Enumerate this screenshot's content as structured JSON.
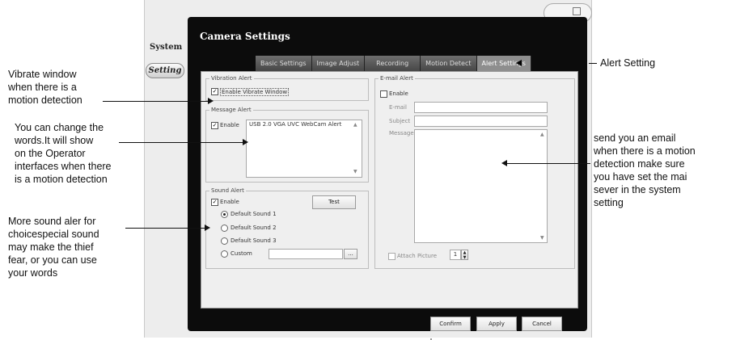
{
  "sidebar": {
    "system_label": "System",
    "setting_button": "Setting"
  },
  "window": {
    "title": "Camera Settings"
  },
  "tabs": [
    {
      "label": "Basic Settings",
      "active": false
    },
    {
      "label": "Image Adjust",
      "active": false
    },
    {
      "label": "Recording",
      "active": false
    },
    {
      "label": "Motion Detect",
      "active": false
    },
    {
      "label": "Alert Settings",
      "active": true
    }
  ],
  "vibration_alert": {
    "title": "Vibration Alert",
    "checkbox_label": "Enable Vibrate Window",
    "checked": true
  },
  "message_alert": {
    "title": "Message Alert",
    "enable_label": "Enable",
    "checked": true,
    "message": "USB 2.0 VGA UVC WebCam Alert"
  },
  "sound_alert": {
    "title": "Sound Alert",
    "enable_label": "Enable",
    "checked": true,
    "test_button": "Test",
    "options": [
      "Default Sound 1",
      "Default Sound 2",
      "Default Sound 3",
      "Custom"
    ],
    "selected_index": 0,
    "browse_button": "..."
  },
  "email_alert": {
    "title": "E-mail Alert",
    "enable_label": "Enable",
    "checked": false,
    "email_label": "E-mail",
    "subject_label": "Subject",
    "message_label": "Message",
    "attach_label": "Attach Picture",
    "attach_count": "1"
  },
  "footer": {
    "confirm": "Confirm",
    "apply": "Apply",
    "cancel": "Cancel"
  },
  "annotations": {
    "vibrate": [
      "Vibrate window",
      "when there is a",
      "motion detection"
    ],
    "words": [
      "You can change the",
      "words.It will show",
      "on the Operator",
      "interfaces when there",
      "is a motion detection"
    ],
    "sound": [
      "More sound aler for",
      "choicespecial sound",
      "may make the thief",
      "fear, or you can use",
      "your words"
    ],
    "alert_setting": "Alert Setting",
    "email": [
      "send you an email",
      "when there is a motion",
      "detection make sure",
      "you have set the mai",
      "sever in the system",
      "setting"
    ]
  },
  "colors": {
    "frame": "#0c0c0c",
    "tab": "#5a5a5a",
    "panel": "#efefef"
  }
}
